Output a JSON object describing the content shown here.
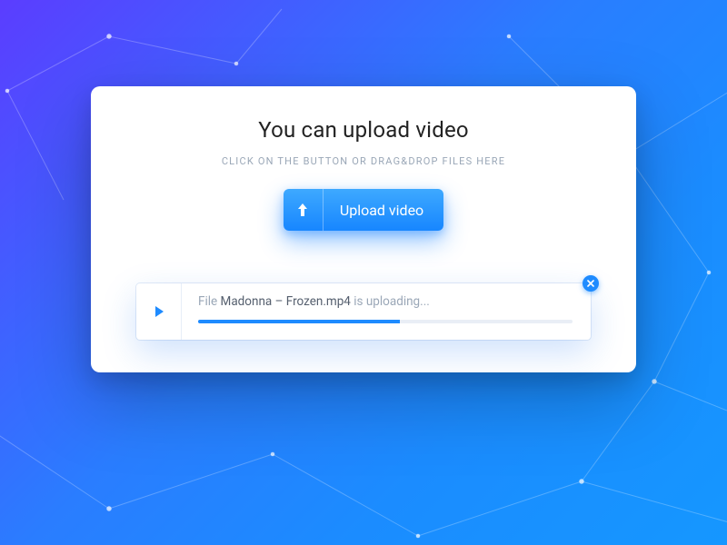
{
  "header": {
    "title": "You can upload video",
    "subtitle": "CLICK ON THE BUTTON OR DRAG&DROP FILES HERE"
  },
  "upload_button": {
    "label": "Upload video"
  },
  "file": {
    "prefix": "File ",
    "name": "Madonna – Frozen.mp4",
    "suffix": " is uploading...",
    "progress_percent": 54
  },
  "colors": {
    "accent": "#1e8bff"
  }
}
